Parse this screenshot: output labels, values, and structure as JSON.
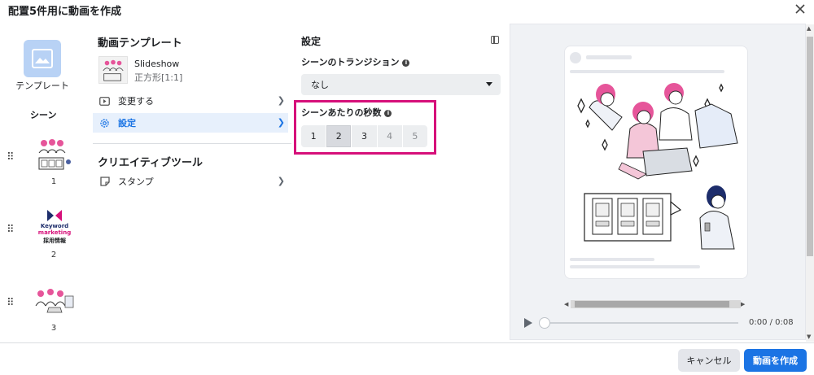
{
  "header": {
    "title": "配置5件用に動画を作成"
  },
  "left_rail": {
    "template_label": "テンプレート",
    "scenes_heading": "シーン",
    "scenes": [
      {
        "number": "1"
      },
      {
        "number": "2",
        "logo_line1": "Keyword",
        "logo_line2": "marketing",
        "logo_line3": "採用情報"
      },
      {
        "number": "3"
      }
    ]
  },
  "template_panel": {
    "heading": "動画テンプレート",
    "template_name": "Slideshow",
    "template_format": "正方形[1:1]",
    "change_label": "変更する",
    "settings_label": "設定",
    "creative_tools_heading": "クリエイティブツール",
    "stamp_label": "スタンプ"
  },
  "settings": {
    "heading": "設定",
    "transition_label": "シーンのトランジション",
    "transition_value": "なし",
    "seconds_label": "シーンあたりの秒数",
    "seconds_options": [
      "1",
      "2",
      "3",
      "4",
      "5"
    ],
    "seconds_selected": "2",
    "highlight_color": "#d6107a"
  },
  "preview": {
    "time": "0:00 / 0:08"
  },
  "footer": {
    "cancel_label": "キャンセル",
    "create_label": "動画を作成",
    "accent_color": "#1b74e4"
  }
}
